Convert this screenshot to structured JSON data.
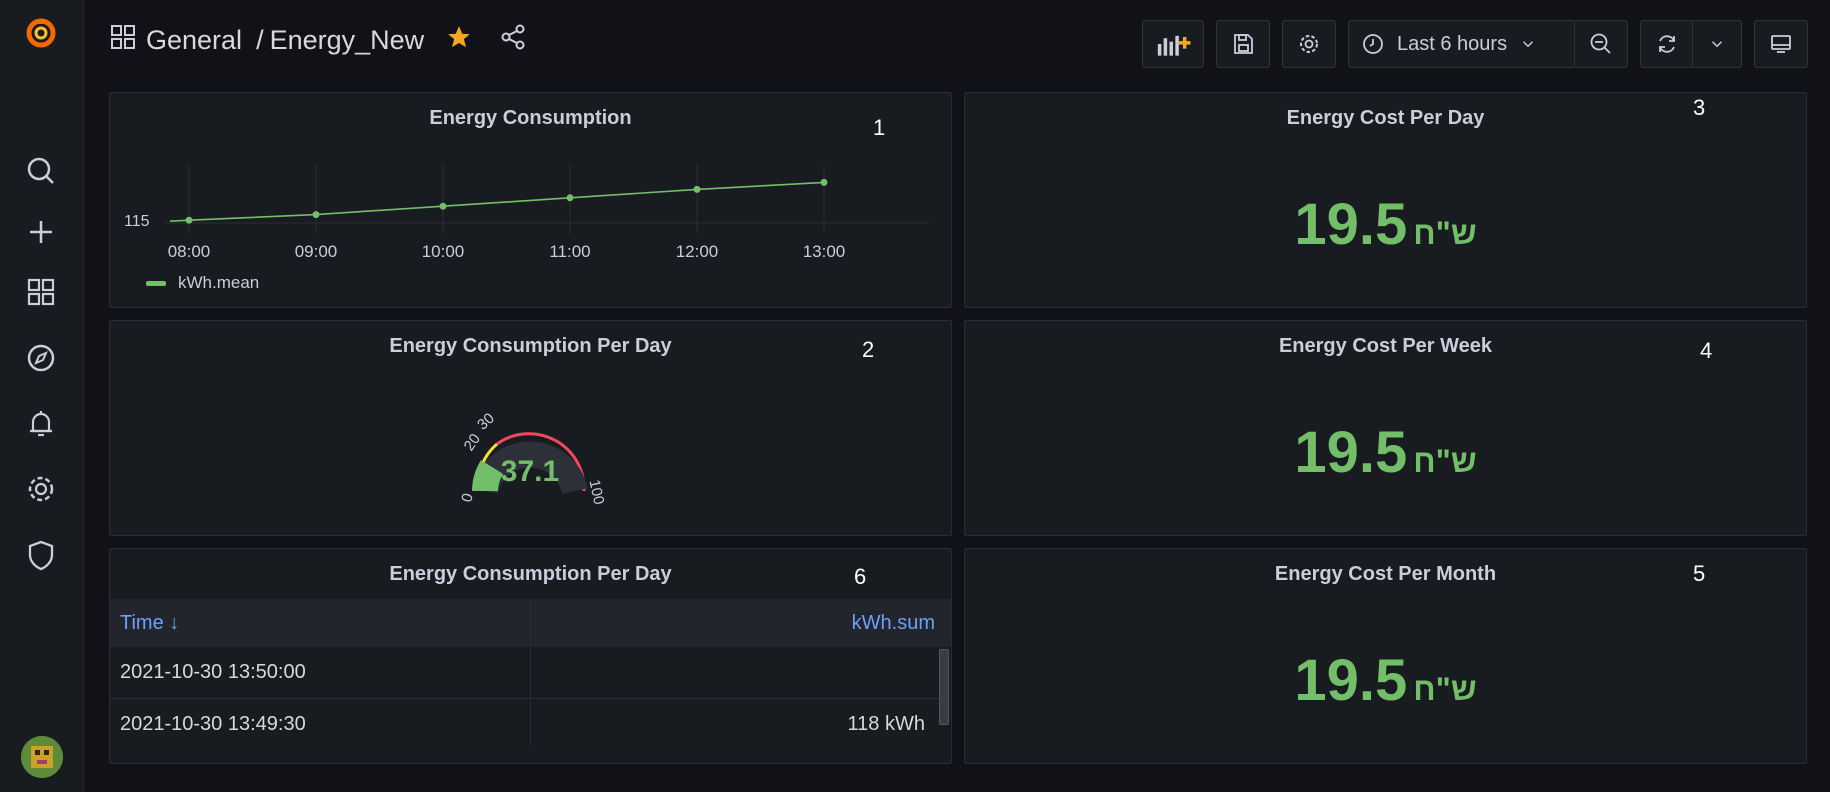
{
  "header": {
    "folder": "General",
    "separator": "/",
    "dashboard": "Energy_New",
    "time_range": "Last 6 hours"
  },
  "panels": {
    "p1": {
      "title": "Energy Consumption",
      "number": "1",
      "y_tick": "115",
      "legend": "kWh.mean"
    },
    "p2": {
      "title": "Energy Consumption Per Day",
      "number": "2",
      "gauge_value": "37.1",
      "gauge_min": "0",
      "gauge_t1": "20",
      "gauge_t2": "30",
      "gauge_max": "100"
    },
    "p3": {
      "title": "Energy Cost Per Day",
      "number": "3",
      "value": "19.5",
      "unit": "ש\"ח"
    },
    "p4": {
      "title": "Energy Cost Per Week",
      "number": "4",
      "value": "19.5",
      "unit": "ש\"ח"
    },
    "p5": {
      "title": "Energy Cost Per Month",
      "number": "5",
      "value": "19.5",
      "unit": "ש\"ח"
    },
    "p6": {
      "title": "Energy Consumption Per Day",
      "number": "6",
      "columns": [
        "Time ↓",
        "kWh.sum"
      ],
      "rows": [
        {
          "time": "2021-10-30 13:50:00",
          "value": ""
        },
        {
          "time": "2021-10-30 13:49:30",
          "value": "118 kWh"
        }
      ]
    }
  },
  "colors": {
    "accent_green": "#73bf69",
    "link_blue": "#6e9fff",
    "star": "#f5a623",
    "gauge_red": "#f2495c",
    "gauge_yellow": "#fade2a"
  },
  "chart_data": {
    "type": "line",
    "x": [
      "08:00",
      "09:00",
      "10:00",
      "11:00",
      "12:00",
      "13:00"
    ],
    "series": [
      {
        "name": "kWh.mean",
        "values": [
          115.2,
          115.6,
          116.2,
          116.8,
          117.4,
          117.9
        ]
      }
    ],
    "ylabel": "",
    "yticks": [
      "115"
    ]
  }
}
